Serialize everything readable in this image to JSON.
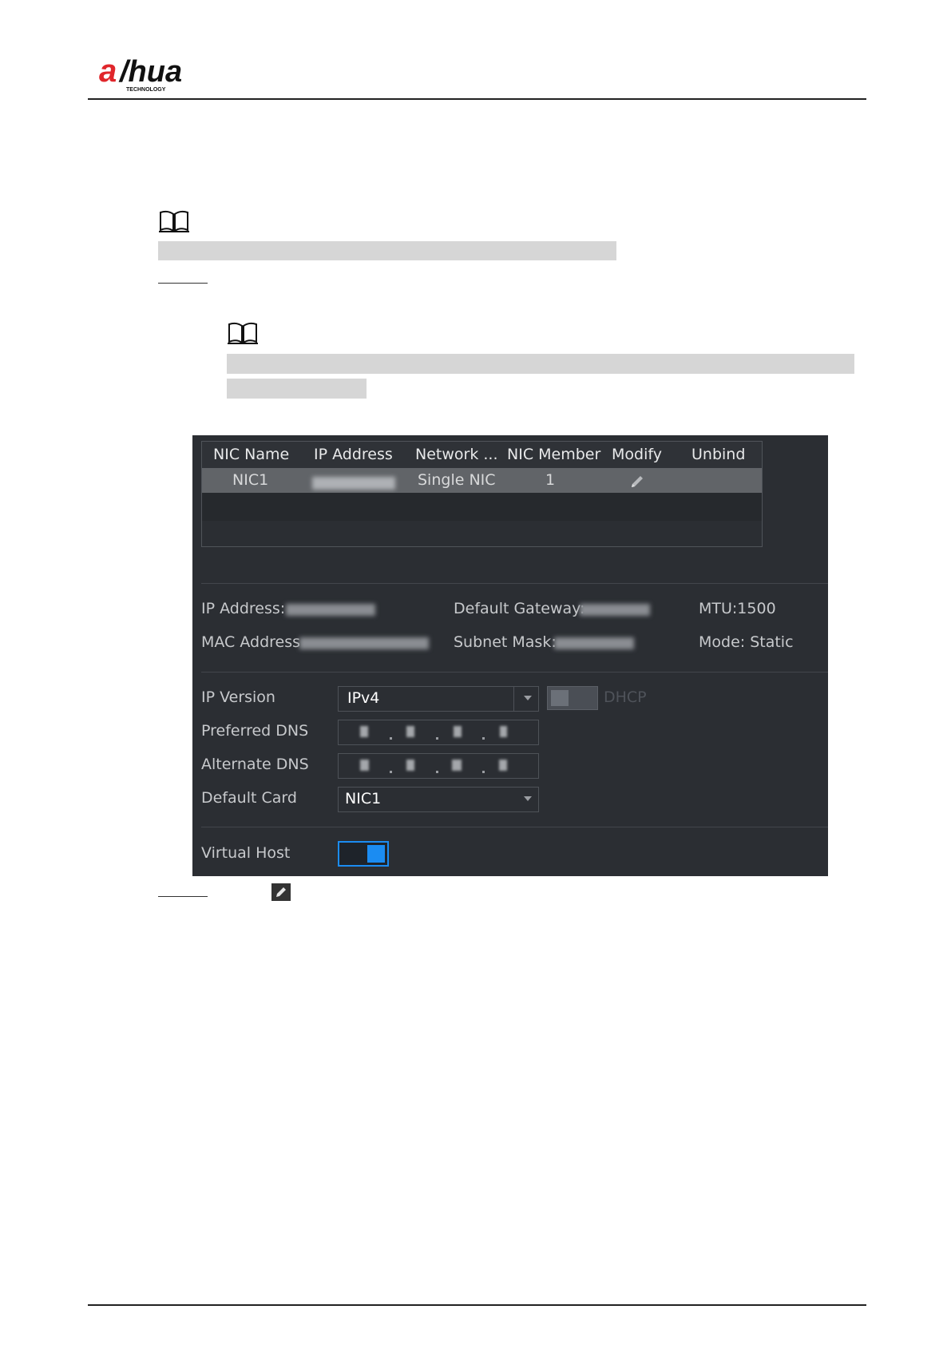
{
  "header": {
    "logo_text": "alhua",
    "logo_subtext": "TECHNOLOGY"
  },
  "icons": {
    "note_icon": "book-icon",
    "modify_icon": "pencil-icon"
  },
  "nic_table": {
    "columns": [
      "NIC Name",
      "IP Address",
      "Network ...",
      "NIC Member",
      "Modify",
      "Unbind"
    ],
    "rows": [
      {
        "nic_name": "NIC1",
        "network": "Single NIC",
        "nic_member": "1"
      }
    ]
  },
  "info": {
    "ip_address_label": "IP Address:",
    "default_gateway_label": "Default Gateway:",
    "mtu": "MTU:1500",
    "mac_address_label": "MAC Address",
    "subnet_mask_label": "Subnet Mask:",
    "mode": "Mode: Static"
  },
  "form": {
    "ip_version_label": "IP Version",
    "ip_version_value": "IPv4",
    "dhcp_label": "DHCP",
    "preferred_dns_label": "Preferred DNS",
    "alternate_dns_label": "Alternate DNS",
    "default_card_label": "Default Card",
    "default_card_value": "NIC1",
    "virtual_host_label": "Virtual Host"
  },
  "colors": {
    "panel_bg": "#2b2e33",
    "accent": "#1b8cf2",
    "logo_red": "#e0262b"
  }
}
